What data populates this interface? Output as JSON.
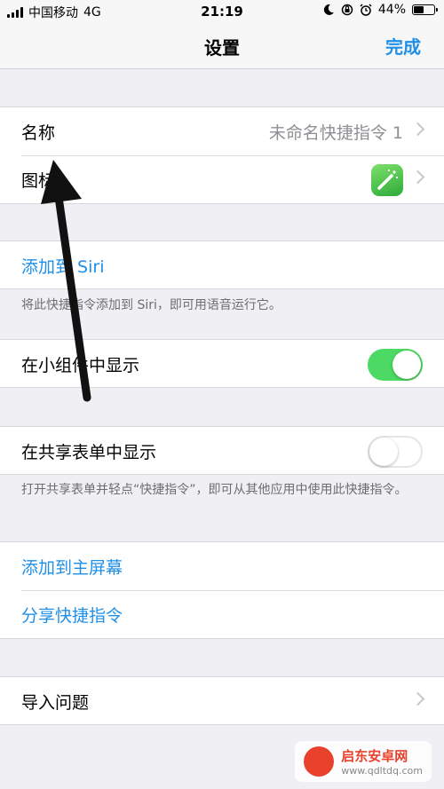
{
  "status": {
    "carrier": "中国移动",
    "network": "4G",
    "time": "21:19",
    "battery": "44%",
    "battery_level": 0.44
  },
  "nav": {
    "title": "设置",
    "done_label": "完成"
  },
  "rows": {
    "name_label": "名称",
    "name_value": "未命名快捷指令 1",
    "icon_label": "图标",
    "add_siri_label": "添加到 Siri",
    "add_siri_footer": "将此快捷指令添加到 Siri，即可用语音运行它。",
    "widget_label": "在小组件中显示",
    "widget_on": true,
    "share_label": "在共享表单中显示",
    "share_on": false,
    "share_footer": "打开共享表单并轻点“快捷指令”，即可从其他应用中使用此快捷指令。",
    "home_label": "添加到主屏幕",
    "share_shortcut_label": "分享快捷指令",
    "import_label": "导入问题"
  },
  "watermark": {
    "name": "启东安卓网",
    "url": "www.qdltdq.com"
  },
  "colors": {
    "accent": "#1f8fe8",
    "toggle_on": "#4cd964",
    "background": "#efeff4"
  }
}
